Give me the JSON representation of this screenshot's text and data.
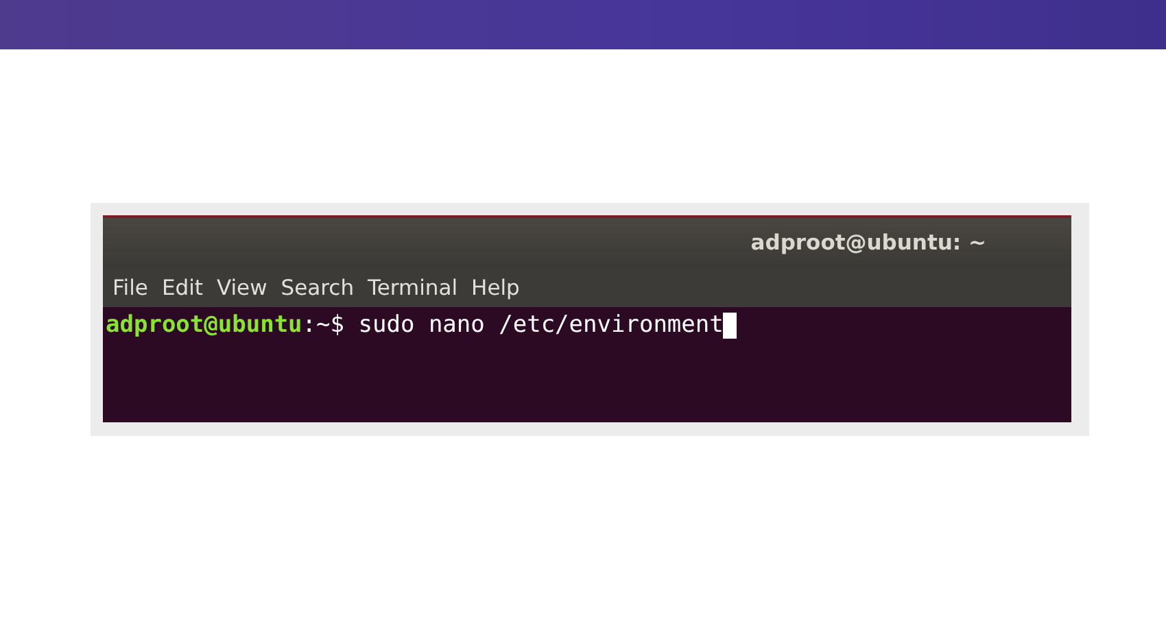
{
  "window": {
    "title": "adproot@ubuntu: ~"
  },
  "menu": [
    "File",
    "Edit",
    "View",
    "Search",
    "Terminal",
    "Help"
  ],
  "terminal": {
    "user_host": "adproot@ubuntu",
    "path_prompt": ":~$",
    "command": "sudo nano /etc/environment",
    "cursor_visible": true
  }
}
